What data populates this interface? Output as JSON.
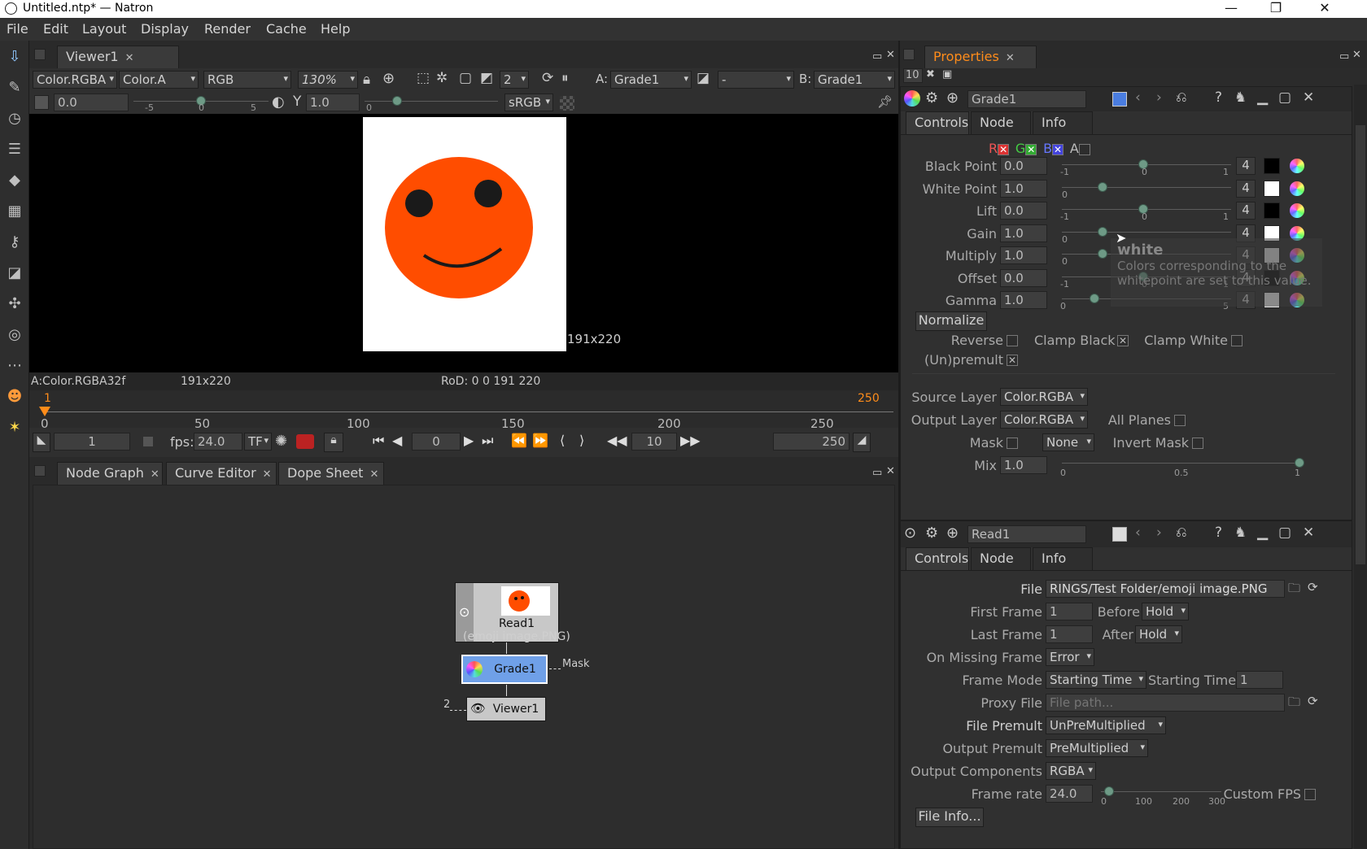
{
  "window": {
    "title": "Untitled.ntp* — Natron"
  },
  "menu": [
    "File",
    "Edit",
    "Layout",
    "Display",
    "Render",
    "Cache",
    "Help"
  ],
  "viewer": {
    "tab": "Viewer1",
    "layer": "Color.RGBA",
    "alpha": "Color.A",
    "channels": "RGB",
    "zoom": "130%",
    "proxy": "2",
    "a_label": "A:",
    "a_input": "Grade1",
    "composite": "-",
    "b_label": "B:",
    "b_input": "Grade1",
    "gain": "0.0",
    "gamma_label": "Y",
    "gamma": "1.0",
    "colorspace": "sRGB",
    "ticks_gain": [
      "-5",
      "0",
      "5"
    ],
    "tick_gamma": "0",
    "image_size_label": "191x220",
    "info_format": "A:Color.RGBA32f",
    "info_size": "191x220",
    "info_rod": "RoD: 0 0 191 220"
  },
  "timeline": {
    "start_marker": "1",
    "end_marker": "250",
    "ticks": [
      "0",
      "50",
      "100",
      "150",
      "200",
      "250"
    ],
    "first_frame": "1",
    "fps_label": "fps:",
    "fps": "24.0",
    "tf": "TF",
    "current_frame": "0",
    "increment": "10",
    "last_frame": "250"
  },
  "bottom_tabs": [
    "Node Graph",
    "Curve Editor",
    "Dope Sheet"
  ],
  "nodegraph": {
    "read_node": {
      "name": "Read1",
      "file": "(emoji image.PNG)"
    },
    "grade_node": {
      "name": "Grade1"
    },
    "viewer_node": {
      "name": "Viewer1"
    },
    "mask_label": "Mask",
    "viewer_input": "2"
  },
  "properties": {
    "title": "Properties",
    "max_panels": "10",
    "grade": {
      "name": "Grade1",
      "tabs": [
        "Controls",
        "Node",
        "Info"
      ],
      "channels": {
        "r": "R",
        "g": "G",
        "b": "B",
        "a": "A"
      },
      "params": [
        {
          "label": "Black Point",
          "value": "0.0",
          "ticks": [
            "-1",
            "0",
            "1"
          ],
          "dims": "4",
          "level": 0.5,
          "swatch": "#000000"
        },
        {
          "label": "White Point",
          "value": "1.0",
          "ticks": [
            "0"
          ],
          "dims": "4",
          "level": 0.25,
          "swatch": "#ffffff"
        },
        {
          "label": "Lift",
          "value": "0.0",
          "ticks": [
            "-1",
            "0",
            "1"
          ],
          "dims": "4",
          "level": 0.5,
          "swatch": "#000000"
        },
        {
          "label": "Gain",
          "value": "1.0",
          "ticks": [
            "0"
          ],
          "dims": "4",
          "level": 0.25,
          "swatch": "#ffffff"
        },
        {
          "label": "Multiply",
          "value": "1.0",
          "ticks": [
            "0"
          ],
          "dims": "4",
          "level": 0.25,
          "swatch": "#d8d8d8"
        },
        {
          "label": "Offset",
          "value": "0.0",
          "ticks": [
            "-1",
            "0",
            "1"
          ],
          "dims": "4",
          "level": 0.5,
          "swatch": "#111111"
        },
        {
          "label": "Gamma",
          "value": "1.0",
          "ticks": [
            "0",
            "5"
          ],
          "dims": "4",
          "level": 0.2,
          "swatch": "#e8e8e8"
        }
      ],
      "tooltip": {
        "title": "white",
        "line1": "Colors corresponding to the",
        "line2": "whitepoint are set to this value."
      },
      "normalize": "Normalize",
      "reverse": "Reverse",
      "clamp_black": "Clamp Black",
      "clamp_white": "Clamp White",
      "unpremult": "(Un)premult",
      "source_layer_label": "Source Layer",
      "source_layer": "Color.RGBA",
      "output_layer_label": "Output Layer",
      "output_layer": "Color.RGBA",
      "all_planes": "All Planes",
      "mask_label": "Mask",
      "mask_value": "None",
      "invert_mask": "Invert Mask",
      "mix_label": "Mix",
      "mix": "1.0",
      "mix_ticks": [
        "0",
        "0.5",
        "1"
      ]
    },
    "read": {
      "name": "Read1",
      "tabs": [
        "Controls",
        "Node",
        "Info"
      ],
      "file_label": "File",
      "file": "RINGS/Test Folder/emoji image.PNG",
      "first_frame_label": "First Frame",
      "first_frame": "1",
      "before_label": "Before",
      "before": "Hold",
      "last_frame_label": "Last Frame",
      "last_frame": "1",
      "after_label": "After",
      "after": "Hold",
      "missing_label": "On Missing Frame",
      "missing": "Error",
      "frame_mode_label": "Frame Mode",
      "frame_mode": "Starting Time",
      "starting_time_label": "Starting Time",
      "starting_time": "1",
      "proxy_label": "Proxy File",
      "proxy_placeholder": "File path...",
      "file_premult_label": "File Premult",
      "file_premult": "UnPreMultiplied",
      "output_premult_label": "Output Premult",
      "output_premult": "PreMultiplied",
      "output_comp_label": "Output Components",
      "output_comp": "RGBA",
      "frame_rate_label": "Frame rate",
      "frame_rate": "24.0",
      "frame_rate_ticks": [
        "0",
        "100",
        "200",
        "300"
      ],
      "custom_fps": "Custom FPS",
      "file_info": "File Info..."
    }
  },
  "colors": {
    "accent_orange": "#ff8c1a",
    "node_selected": "#6fa0e8",
    "emoji_face": "#ff4d00"
  }
}
